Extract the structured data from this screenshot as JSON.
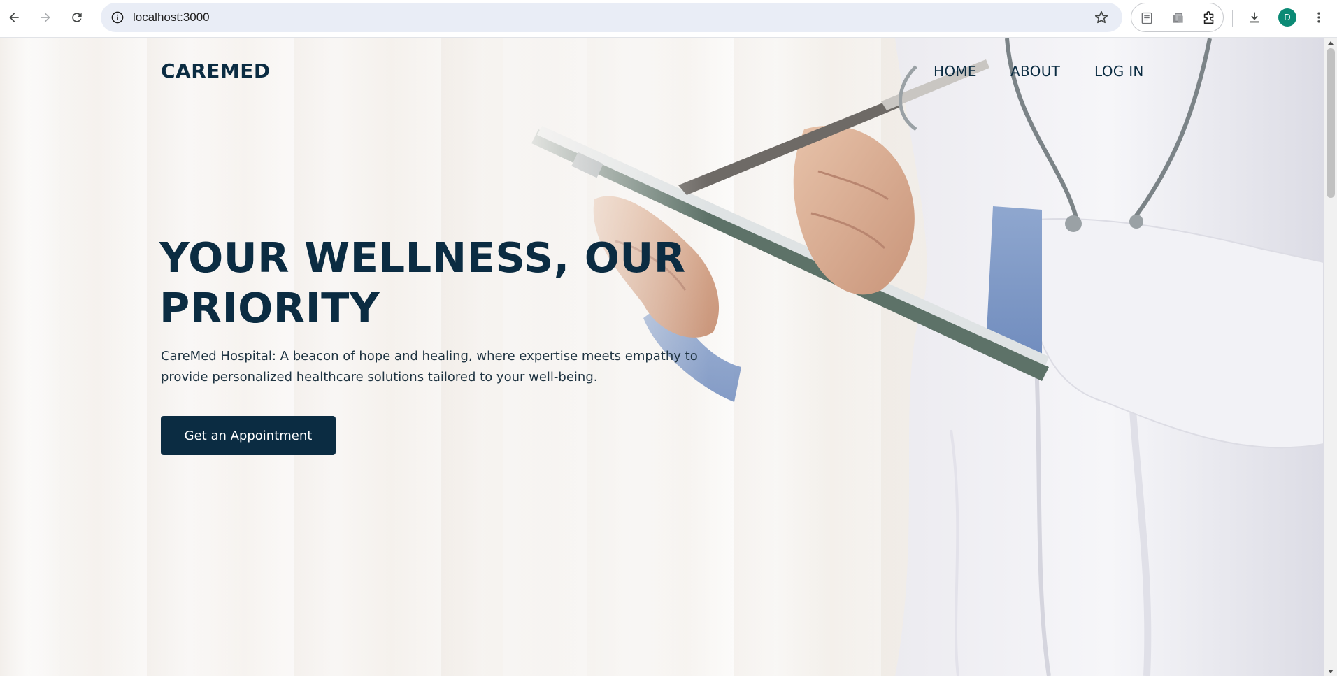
{
  "browser": {
    "url": "localhost:3000",
    "avatar_initial": "D"
  },
  "site": {
    "logo": "CAREMED",
    "nav": {
      "home": "HOME",
      "about": "ABOUT",
      "login": "LOG IN"
    },
    "hero": {
      "title": "YOUR WELLNESS, OUR PRIORITY",
      "description": "CareMed Hospital: A beacon of hope and healing, where expertise meets empathy to provide personalized healthcare solutions tailored to your well-being.",
      "cta_label": "Get an Appointment"
    }
  },
  "colors": {
    "brand_navy": "#0b2c42",
    "avatar_bg": "#0b8a75",
    "address_bar_bg": "#e9edf6"
  },
  "icons": {
    "back": "back-arrow-icon",
    "forward": "forward-arrow-icon",
    "reload": "reload-icon",
    "site_info": "info-icon",
    "bookmark": "star-icon",
    "reading_mode": "reading-list-icon",
    "tab_search": "copy-pages-icon",
    "extensions": "puzzle-icon",
    "download": "download-icon",
    "menu": "kebab-menu-icon"
  }
}
